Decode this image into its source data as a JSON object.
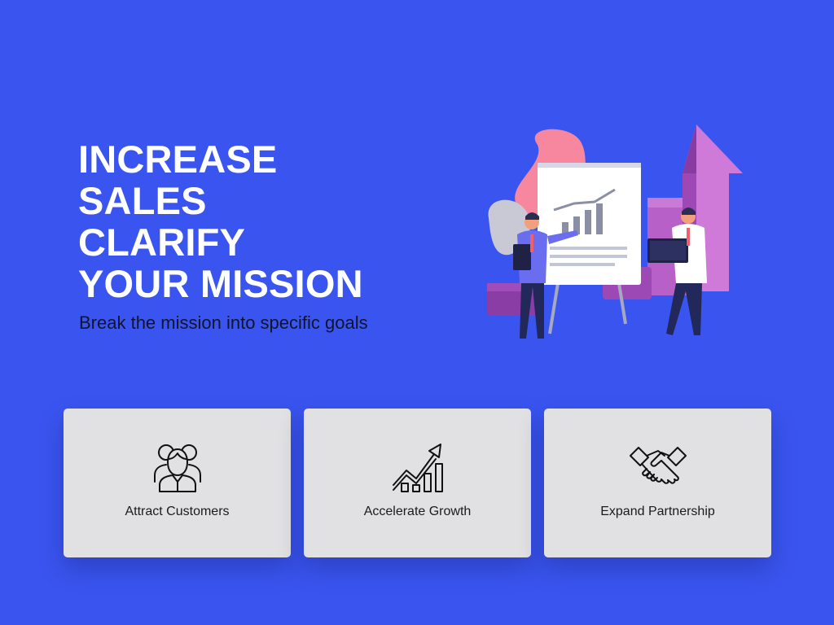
{
  "hero": {
    "title_lines": [
      "INCREASE",
      "SALES",
      "CLARIFY",
      "YOUR MISSION"
    ],
    "subtitle": "Break the mission into specific goals"
  },
  "cards": [
    {
      "label": "Attract Customers",
      "icon": "customers-group-icon"
    },
    {
      "label": "Accelerate Growth",
      "icon": "growth-chart-icon"
    },
    {
      "label": "Expand Partnership",
      "icon": "handshake-icon"
    }
  ],
  "colors": {
    "background": "#3a55ef",
    "card": "#e1e1e3",
    "headline": "#ffffff",
    "subtitle": "#10152b"
  }
}
